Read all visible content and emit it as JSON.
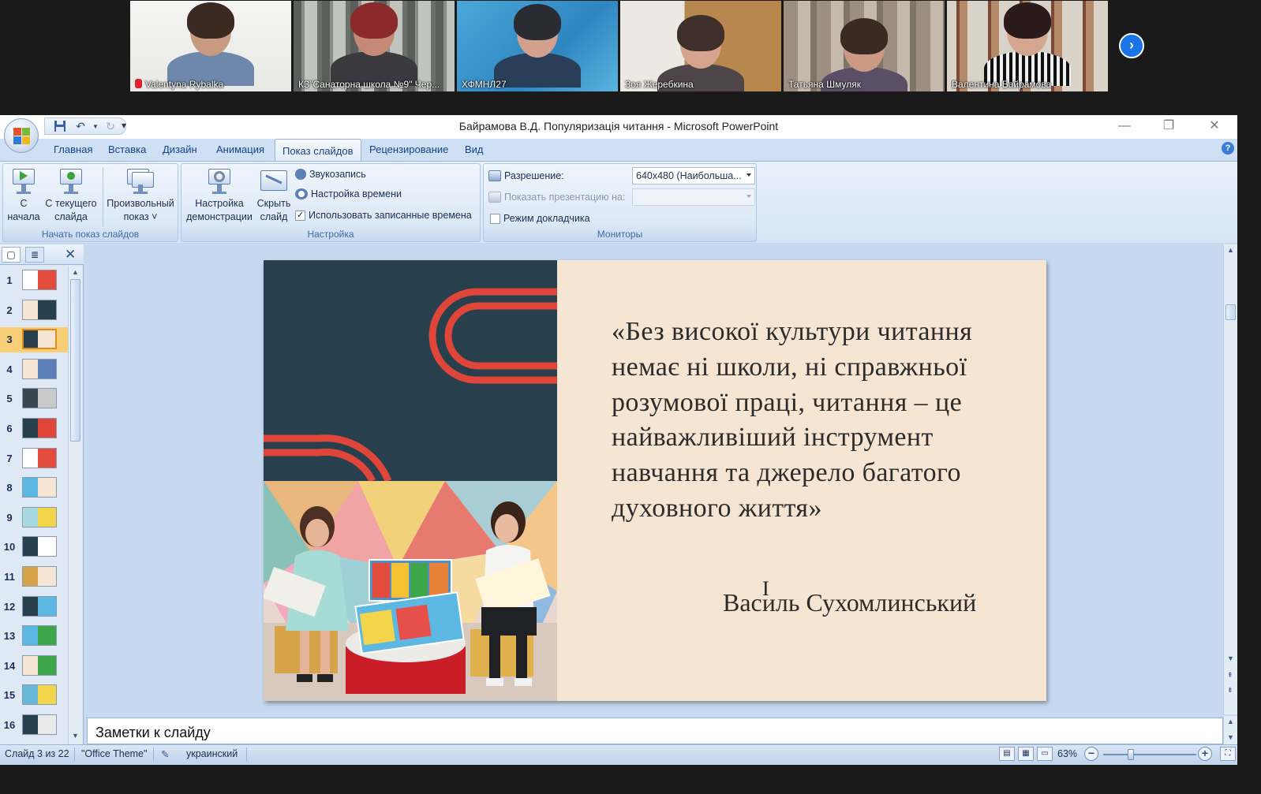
{
  "meeting": {
    "participants": [
      {
        "name": "Valentyna Rybalka",
        "muted": true
      },
      {
        "name": "КЗ\"Санаторна школа №9\" Чер...",
        "muted": false
      },
      {
        "name": "ХФМНЛ27",
        "muted": false
      },
      {
        "name": "Зоя Жеребкина",
        "muted": false
      },
      {
        "name": "Татьяна Шмуляк",
        "muted": false
      },
      {
        "name": "Валентина Байрамова",
        "muted": false
      }
    ],
    "next_page_icon": "chevron-right-icon"
  },
  "window": {
    "title": "Байрамова В.Д. Популяризація читання - Microsoft PowerPoint",
    "controls": [
      "—",
      "❐",
      "✕"
    ]
  },
  "ribbon": {
    "tabs": [
      "Главная",
      "Вставка",
      "Дизайн",
      "Анимация",
      "Показ слайдов",
      "Рецензирование",
      "Вид"
    ],
    "active_tab": "Показ слайдов",
    "groups": {
      "start": {
        "label": "Начать показ слайдов",
        "from_beginning": [
          "С",
          "начала"
        ],
        "from_current": [
          "С текущего",
          "слайда"
        ],
        "custom_show": [
          "Произвольный",
          "показ ˅"
        ]
      },
      "setup": {
        "label": "Настройка",
        "setup_show": [
          "Настройка",
          "демонстрации"
        ],
        "hide_slide": [
          "Скрыть",
          "слайд"
        ],
        "record_narration": "Звукозапись",
        "rehearse_timings": "Настройка времени",
        "use_rehearsed": "Использовать записанные времена",
        "use_rehearsed_checked": true
      },
      "monitors": {
        "label": "Мониторы",
        "resolution_label": "Разрешение:",
        "resolution_value": "640x480 (Наибольша...",
        "show_on_label": "Показать презентацию на:",
        "show_on_value": "",
        "presenter_view": "Режим докладчика",
        "presenter_view_checked": false
      }
    }
  },
  "slides_panel": {
    "count_shown": 16,
    "selected": 3,
    "numbers": [
      "1",
      "2",
      "3",
      "4",
      "5",
      "6",
      "7",
      "8",
      "9",
      "10",
      "11",
      "12",
      "13",
      "14",
      "15",
      "16"
    ]
  },
  "slide": {
    "quote": "«Без високої культури читання немає ні школи, ні справжньої розумової праці, читання – це найважливіший інструмент навчання та джерело багатого духовного життя»",
    "author": "Василь Сухомлинський",
    "colors": {
      "dark": "#28404d",
      "accent": "#e0453a",
      "bg": "#f7e5d4"
    }
  },
  "notes": {
    "placeholder": "Заметки к слайду"
  },
  "status": {
    "slide_info": "Слайд 3 из 22",
    "theme": "\"Office Theme\"",
    "language": "украинский",
    "zoom": "63%",
    "zoom_fraction": 0.63
  }
}
